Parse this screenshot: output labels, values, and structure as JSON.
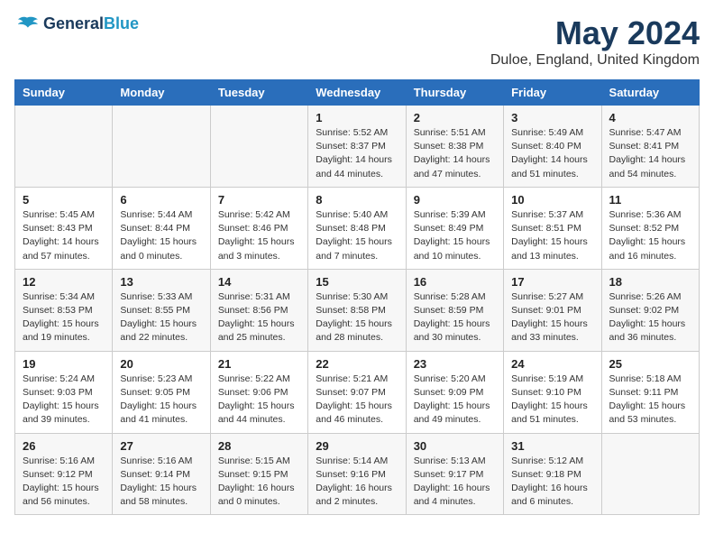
{
  "header": {
    "logo_line1": "General",
    "logo_line2": "Blue",
    "title": "May 2024",
    "subtitle": "Duloe, England, United Kingdom"
  },
  "days_of_week": [
    "Sunday",
    "Monday",
    "Tuesday",
    "Wednesday",
    "Thursday",
    "Friday",
    "Saturday"
  ],
  "weeks": [
    [
      {
        "day": "",
        "info": ""
      },
      {
        "day": "",
        "info": ""
      },
      {
        "day": "",
        "info": ""
      },
      {
        "day": "1",
        "info": "Sunrise: 5:52 AM\nSunset: 8:37 PM\nDaylight: 14 hours\nand 44 minutes."
      },
      {
        "day": "2",
        "info": "Sunrise: 5:51 AM\nSunset: 8:38 PM\nDaylight: 14 hours\nand 47 minutes."
      },
      {
        "day": "3",
        "info": "Sunrise: 5:49 AM\nSunset: 8:40 PM\nDaylight: 14 hours\nand 51 minutes."
      },
      {
        "day": "4",
        "info": "Sunrise: 5:47 AM\nSunset: 8:41 PM\nDaylight: 14 hours\nand 54 minutes."
      }
    ],
    [
      {
        "day": "5",
        "info": "Sunrise: 5:45 AM\nSunset: 8:43 PM\nDaylight: 14 hours\nand 57 minutes."
      },
      {
        "day": "6",
        "info": "Sunrise: 5:44 AM\nSunset: 8:44 PM\nDaylight: 15 hours\nand 0 minutes."
      },
      {
        "day": "7",
        "info": "Sunrise: 5:42 AM\nSunset: 8:46 PM\nDaylight: 15 hours\nand 3 minutes."
      },
      {
        "day": "8",
        "info": "Sunrise: 5:40 AM\nSunset: 8:48 PM\nDaylight: 15 hours\nand 7 minutes."
      },
      {
        "day": "9",
        "info": "Sunrise: 5:39 AM\nSunset: 8:49 PM\nDaylight: 15 hours\nand 10 minutes."
      },
      {
        "day": "10",
        "info": "Sunrise: 5:37 AM\nSunset: 8:51 PM\nDaylight: 15 hours\nand 13 minutes."
      },
      {
        "day": "11",
        "info": "Sunrise: 5:36 AM\nSunset: 8:52 PM\nDaylight: 15 hours\nand 16 minutes."
      }
    ],
    [
      {
        "day": "12",
        "info": "Sunrise: 5:34 AM\nSunset: 8:53 PM\nDaylight: 15 hours\nand 19 minutes."
      },
      {
        "day": "13",
        "info": "Sunrise: 5:33 AM\nSunset: 8:55 PM\nDaylight: 15 hours\nand 22 minutes."
      },
      {
        "day": "14",
        "info": "Sunrise: 5:31 AM\nSunset: 8:56 PM\nDaylight: 15 hours\nand 25 minutes."
      },
      {
        "day": "15",
        "info": "Sunrise: 5:30 AM\nSunset: 8:58 PM\nDaylight: 15 hours\nand 28 minutes."
      },
      {
        "day": "16",
        "info": "Sunrise: 5:28 AM\nSunset: 8:59 PM\nDaylight: 15 hours\nand 30 minutes."
      },
      {
        "day": "17",
        "info": "Sunrise: 5:27 AM\nSunset: 9:01 PM\nDaylight: 15 hours\nand 33 minutes."
      },
      {
        "day": "18",
        "info": "Sunrise: 5:26 AM\nSunset: 9:02 PM\nDaylight: 15 hours\nand 36 minutes."
      }
    ],
    [
      {
        "day": "19",
        "info": "Sunrise: 5:24 AM\nSunset: 9:03 PM\nDaylight: 15 hours\nand 39 minutes."
      },
      {
        "day": "20",
        "info": "Sunrise: 5:23 AM\nSunset: 9:05 PM\nDaylight: 15 hours\nand 41 minutes."
      },
      {
        "day": "21",
        "info": "Sunrise: 5:22 AM\nSunset: 9:06 PM\nDaylight: 15 hours\nand 44 minutes."
      },
      {
        "day": "22",
        "info": "Sunrise: 5:21 AM\nSunset: 9:07 PM\nDaylight: 15 hours\nand 46 minutes."
      },
      {
        "day": "23",
        "info": "Sunrise: 5:20 AM\nSunset: 9:09 PM\nDaylight: 15 hours\nand 49 minutes."
      },
      {
        "day": "24",
        "info": "Sunrise: 5:19 AM\nSunset: 9:10 PM\nDaylight: 15 hours\nand 51 minutes."
      },
      {
        "day": "25",
        "info": "Sunrise: 5:18 AM\nSunset: 9:11 PM\nDaylight: 15 hours\nand 53 minutes."
      }
    ],
    [
      {
        "day": "26",
        "info": "Sunrise: 5:16 AM\nSunset: 9:12 PM\nDaylight: 15 hours\nand 56 minutes."
      },
      {
        "day": "27",
        "info": "Sunrise: 5:16 AM\nSunset: 9:14 PM\nDaylight: 15 hours\nand 58 minutes."
      },
      {
        "day": "28",
        "info": "Sunrise: 5:15 AM\nSunset: 9:15 PM\nDaylight: 16 hours\nand 0 minutes."
      },
      {
        "day": "29",
        "info": "Sunrise: 5:14 AM\nSunset: 9:16 PM\nDaylight: 16 hours\nand 2 minutes."
      },
      {
        "day": "30",
        "info": "Sunrise: 5:13 AM\nSunset: 9:17 PM\nDaylight: 16 hours\nand 4 minutes."
      },
      {
        "day": "31",
        "info": "Sunrise: 5:12 AM\nSunset: 9:18 PM\nDaylight: 16 hours\nand 6 minutes."
      },
      {
        "day": "",
        "info": ""
      }
    ]
  ]
}
